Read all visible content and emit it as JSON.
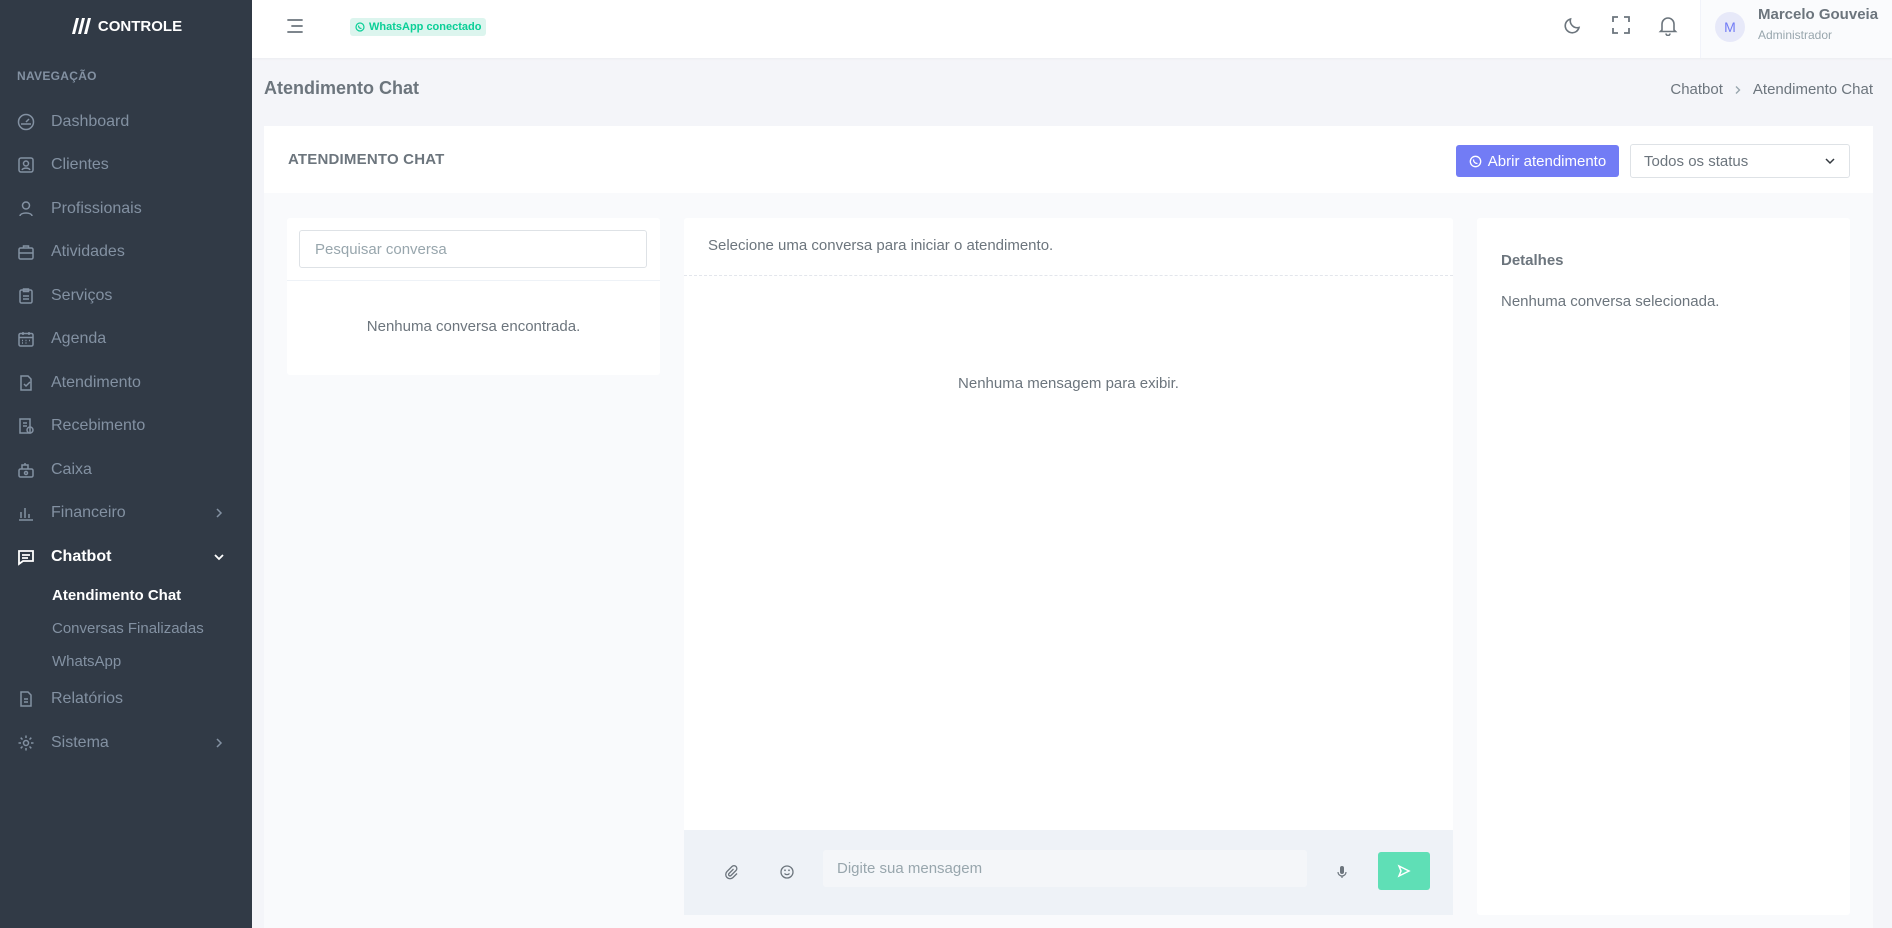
{
  "brand": {
    "name": "CONTROLE"
  },
  "sidebar": {
    "section_title": "NAVEGAÇÃO",
    "items": [
      {
        "label": "Dashboard",
        "icon": "dashboard-icon"
      },
      {
        "label": "Clientes",
        "icon": "clients-icon"
      },
      {
        "label": "Profissionais",
        "icon": "professionals-icon"
      },
      {
        "label": "Atividades",
        "icon": "briefcase-icon"
      },
      {
        "label": "Serviços",
        "icon": "clipboard-icon"
      },
      {
        "label": "Agenda",
        "icon": "calendar-icon"
      },
      {
        "label": "Atendimento",
        "icon": "document-icon"
      },
      {
        "label": "Recebimento",
        "icon": "receipt-icon"
      },
      {
        "label": "Caixa",
        "icon": "cash-register-icon"
      },
      {
        "label": "Financeiro",
        "icon": "bar-chart-icon"
      },
      {
        "label": "Chatbot",
        "icon": "chat-icon"
      },
      {
        "label": "Relatórios",
        "icon": "report-icon"
      },
      {
        "label": "Sistema",
        "icon": "gear-icon"
      }
    ],
    "chatbot_sub": [
      "Atendimento Chat",
      "Conversas Finalizadas",
      "WhatsApp"
    ],
    "active_item": "Chatbot",
    "active_sub": "Atendimento Chat"
  },
  "topbar": {
    "whatsapp_status": "WhatsApp conectado",
    "user": {
      "initial": "M",
      "name": "Marcelo Gouveia",
      "role": "Administrador"
    }
  },
  "page": {
    "title": "Atendimento Chat",
    "breadcrumb": [
      "Chatbot",
      "Atendimento Chat"
    ]
  },
  "card": {
    "title": "ATENDIMENTO CHAT",
    "open_button": "Abrir atendimento",
    "status_filter": "Todos os status"
  },
  "conversations": {
    "search_placeholder": "Pesquisar conversa",
    "empty": "Nenhuma conversa encontrada."
  },
  "chat": {
    "hint": "Selecione uma conversa para iniciar o atendimento.",
    "empty": "Nenhuma mensagem para exibir.",
    "input_placeholder": "Digite sua mensagem"
  },
  "details": {
    "title": "Detalhes",
    "empty": "Nenhuma conversa selecionada."
  },
  "colors": {
    "sidebar_bg": "#313a46",
    "primary": "#727cf5",
    "success": "#0acf97",
    "send_button": "#5fdfb6"
  }
}
